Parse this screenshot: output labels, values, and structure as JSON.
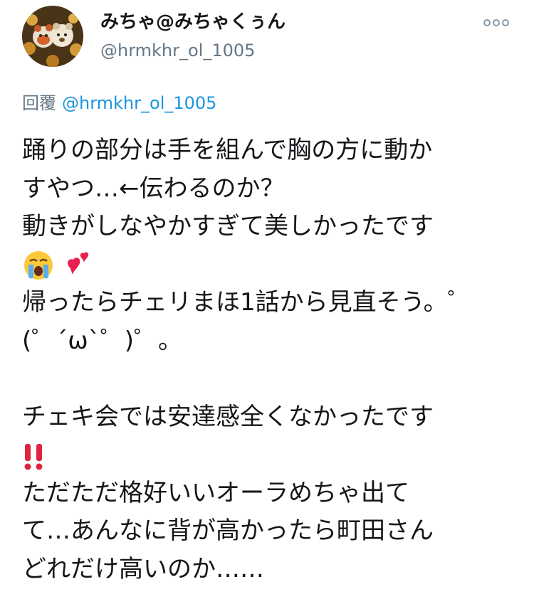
{
  "tweet": {
    "display_name": "みちゃ@みちゃくぅん",
    "handle": "@hrmkhr_ol_1005",
    "replying_label": "回覆",
    "replying_mention": "@hrmkhr_ol_1005",
    "lines": [
      "踊りの部分は手を組んで胸の方に動か",
      "すやつ…←伝わるのか？",
      "動きがしなやかすぎて美しかったです",
      "",
      "帰ったらチェリまほ1話から見直そう。゜",
      "(゜´ω`゜)゜。",
      "",
      "チェキ会では安達感全くなかったです",
      "",
      "ただただ格好いいオーラめちゃ出て",
      "て…あんなに背が高かったら町田さん",
      "どれだけ高いのか……"
    ],
    "emojis": {
      "line4": [
        "crying-face-emoji",
        "two-hearts-emoji"
      ],
      "line9": [
        "double-exclamation-emoji"
      ]
    }
  },
  "colors": {
    "text": "#14171a",
    "secondary": "#657786",
    "link": "#1b95e0",
    "exclamation": "#e0243f",
    "heart": "#e8204f"
  }
}
